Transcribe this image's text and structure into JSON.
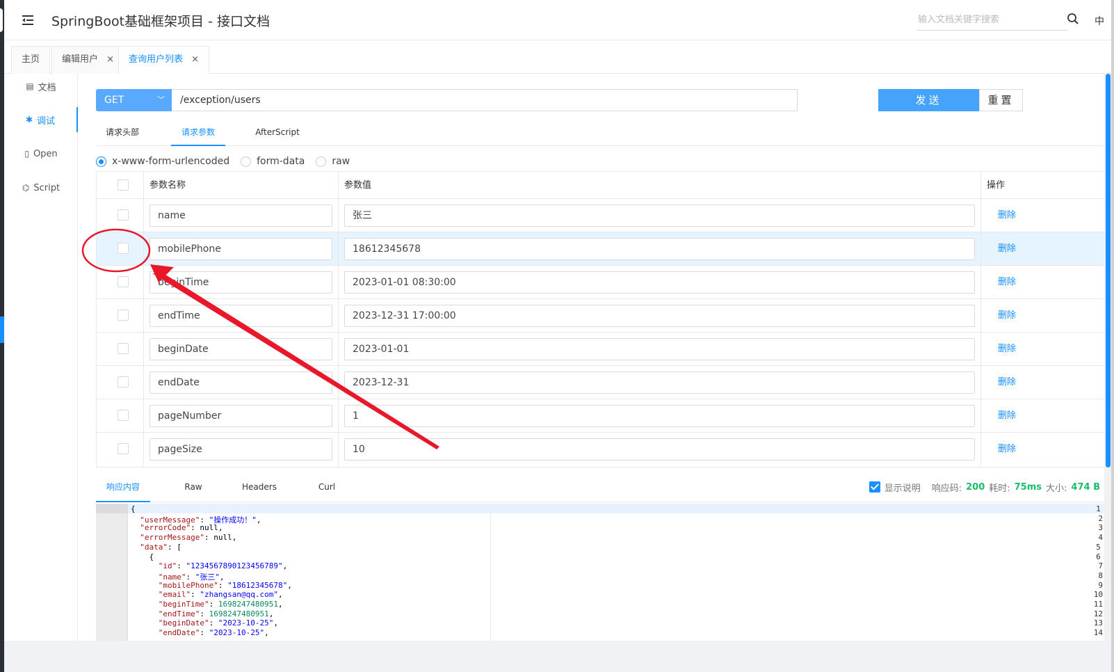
{
  "header": {
    "title": "SpringBoot基础框架项目 - 接口文档",
    "search_placeholder": "输入文档关键字搜索",
    "lang": "中"
  },
  "page_tabs": [
    {
      "label": "主页",
      "closable": false
    },
    {
      "label": "编辑用户",
      "closable": true
    },
    {
      "label": "查询用户列表",
      "closable": true,
      "active": true
    }
  ],
  "close_glyph": "×",
  "sidenav": [
    {
      "label": "文档",
      "icon": "document-icon"
    },
    {
      "label": "调试",
      "icon": "bug-icon",
      "active": true
    },
    {
      "label": "Open",
      "icon": "file-icon"
    },
    {
      "label": "Script",
      "icon": "code-icon"
    }
  ],
  "request": {
    "method": "GET",
    "url": "/exception/users",
    "send_label": "发送",
    "reset_label": "重置"
  },
  "request_tabs": [
    {
      "label": "请求头部"
    },
    {
      "label": "请求参数",
      "active": true
    },
    {
      "label": "AfterScript"
    }
  ],
  "content_types": [
    {
      "label": "x-www-form-urlencoded",
      "selected": true
    },
    {
      "label": "form-data",
      "selected": false
    },
    {
      "label": "raw",
      "selected": false
    }
  ],
  "params_table": {
    "columns": [
      "参数名称",
      "参数值",
      "操作"
    ],
    "delete_label": "删除",
    "rows": [
      {
        "name": "name",
        "value": "张三"
      },
      {
        "name": "mobilePhone",
        "value": "18612345678"
      },
      {
        "name": "beginTime",
        "value": "2023-01-01 08:30:00"
      },
      {
        "name": "endTime",
        "value": "2023-12-31 17:00:00"
      },
      {
        "name": "beginDate",
        "value": "2023-01-01"
      },
      {
        "name": "endDate",
        "value": "2023-12-31"
      },
      {
        "name": "pageNumber",
        "value": "1"
      },
      {
        "name": "pageSize",
        "value": "10"
      }
    ]
  },
  "response_tabs": [
    {
      "label": "响应内容",
      "active": true
    },
    {
      "label": "Raw"
    },
    {
      "label": "Headers"
    },
    {
      "label": "Curl"
    }
  ],
  "response_info": {
    "show_desc_label": "显示说明",
    "code_label": "响应码:",
    "code": "200",
    "time_label": "耗时:",
    "time": "75ms",
    "size_label": "大小:",
    "size": "474 B"
  },
  "response_code_lines": [
    "{",
    "  \"userMessage\": \"操作成功！\",",
    "  \"errorCode\": null,",
    "  \"errorMessage\": null,",
    "  \"data\": [",
    "    {",
    "      \"id\": \"1234567890123456789\",",
    "      \"name\": \"张三\",",
    "      \"mobilePhone\": \"18612345678\",",
    "      \"email\": \"zhangsan@qq.com\",",
    "      \"beginTime\": 1698247480951,",
    "      \"endTime\": 1698247480951,",
    "      \"beginDate\": \"2023-10-25\",",
    "      \"endDate\": \"2023-10-25\","
  ],
  "colors": {
    "accent": "#1890ff",
    "annotation": "#e8182a",
    "success": "#19be6b"
  }
}
